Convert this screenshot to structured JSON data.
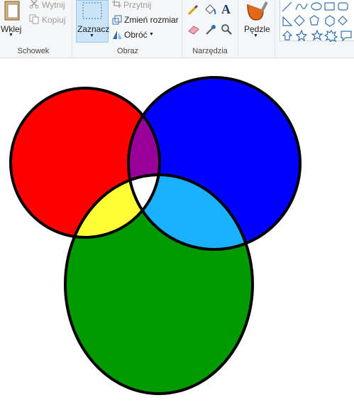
{
  "ribbon": {
    "clipboard": {
      "paste_label": "Wklej",
      "cut_label": "Wytnij",
      "copy_label": "Kopiuj",
      "group_label": "Schowek"
    },
    "image": {
      "select_label": "Zaznacz",
      "crop_label": "Przytnij",
      "resize_label": "Zmień rozmiar",
      "rotate_label": "Obróć",
      "group_label": "Obraz"
    },
    "tools": {
      "text_tool_glyph": "A",
      "group_label": "Narzędzia"
    },
    "brushes": {
      "label": "Pędzle"
    }
  },
  "venn": {
    "colors": {
      "red": "#ff0000",
      "blue": "#0000ff",
      "green": "#009900",
      "purple": "#990099",
      "yellow": "#ffff33",
      "cyan": "#1ab2ff",
      "white": "#ffffff",
      "outline": "#000000"
    }
  }
}
